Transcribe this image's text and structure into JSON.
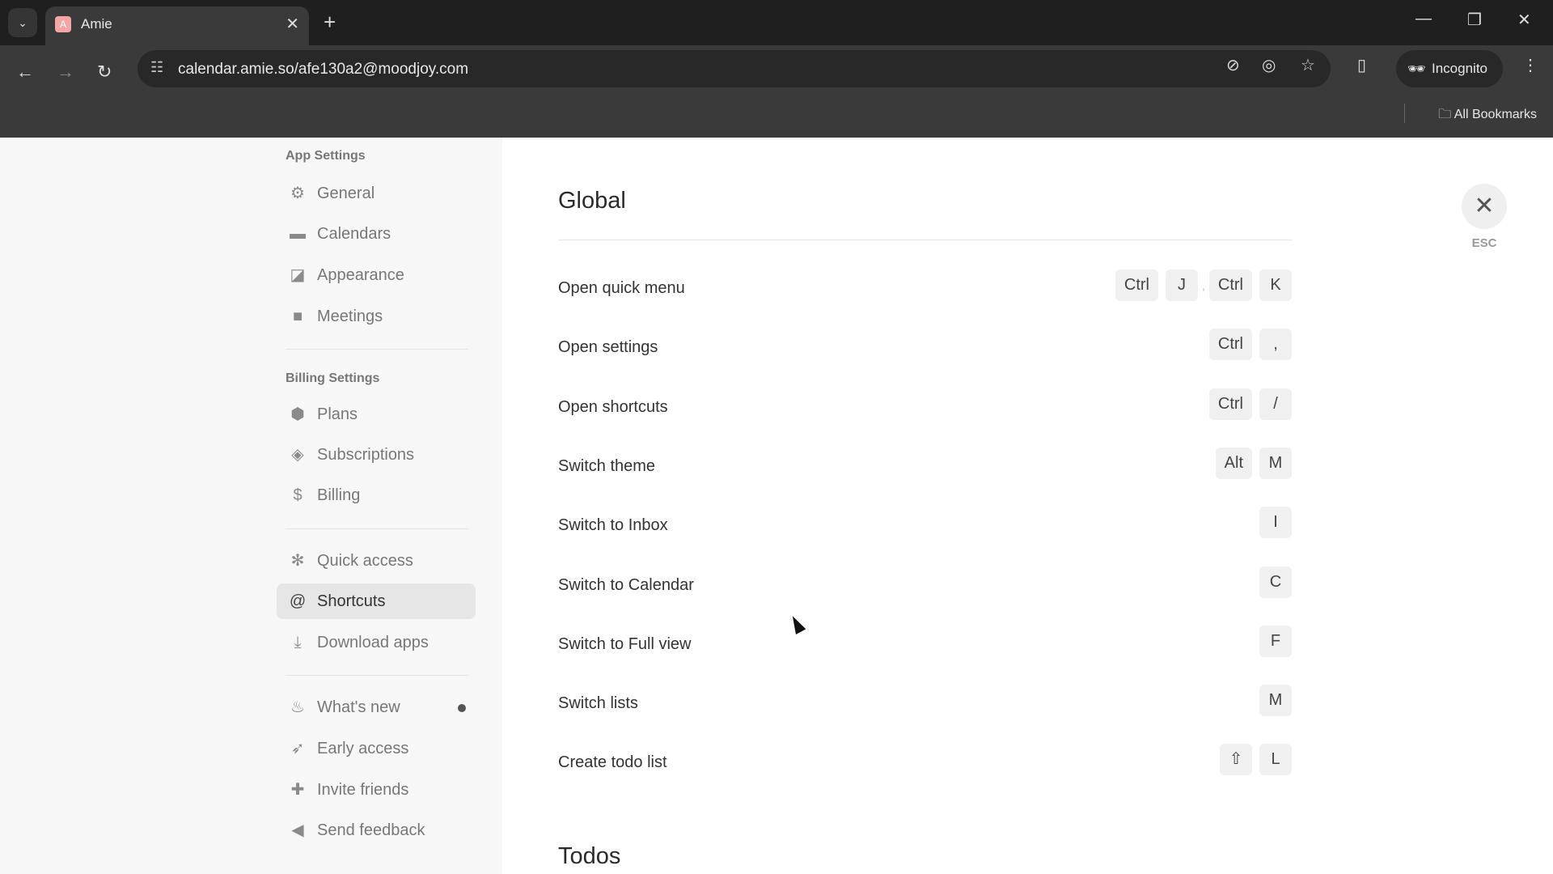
{
  "browser": {
    "tab_title": "Amie",
    "url": "calendar.amie.so/afe130a2@moodjoy.com",
    "incognito_label": "Incognito",
    "bookmarks_label": "All Bookmarks"
  },
  "sidebar": {
    "app_settings_header": "App Settings",
    "app_items": [
      {
        "label": "General",
        "icon": "gear-icon"
      },
      {
        "label": "Calendars",
        "icon": "calendar-icon"
      },
      {
        "label": "Appearance",
        "icon": "appearance-icon"
      },
      {
        "label": "Meetings",
        "icon": "video-icon"
      }
    ],
    "billing_settings_header": "Billing Settings",
    "billing_items": [
      {
        "label": "Plans",
        "icon": "hexagon-icon"
      },
      {
        "label": "Subscriptions",
        "icon": "box-icon"
      },
      {
        "label": "Billing",
        "icon": "dollar-icon"
      }
    ],
    "tool_items": [
      {
        "label": "Quick access",
        "icon": "wheel-icon"
      },
      {
        "label": "Shortcuts",
        "icon": "at-icon",
        "active": true
      },
      {
        "label": "Download apps",
        "icon": "download-icon"
      }
    ],
    "misc_items": [
      {
        "label": "What's new",
        "icon": "flame-icon",
        "has_dot": true
      },
      {
        "label": "Early access",
        "icon": "rocket-icon"
      },
      {
        "label": "Invite friends",
        "icon": "gift-icon"
      },
      {
        "label": "Send feedback",
        "icon": "megaphone-icon"
      }
    ]
  },
  "main": {
    "section_title": "Global",
    "shortcuts": [
      {
        "label": "Open quick menu",
        "keys": [
          "Ctrl",
          "J"
        ],
        "alt_keys": [
          "Ctrl",
          "K"
        ],
        "separator": ","
      },
      {
        "label": "Open settings",
        "keys": [
          "Ctrl",
          ","
        ]
      },
      {
        "label": "Open shortcuts",
        "keys": [
          "Ctrl",
          "/"
        ]
      },
      {
        "label": "Switch theme",
        "keys": [
          "Alt",
          "M"
        ]
      },
      {
        "label": "Switch to Inbox",
        "keys": [
          "I"
        ]
      },
      {
        "label": "Switch to Calendar",
        "keys": [
          "C"
        ]
      },
      {
        "label": "Switch to Full view",
        "keys": [
          "F"
        ]
      },
      {
        "label": "Switch lists",
        "keys": [
          "M"
        ]
      },
      {
        "label": "Create todo list",
        "keys": [
          "⇧",
          "L"
        ]
      }
    ],
    "next_section_title": "Todos",
    "close_hint": "ESC"
  }
}
